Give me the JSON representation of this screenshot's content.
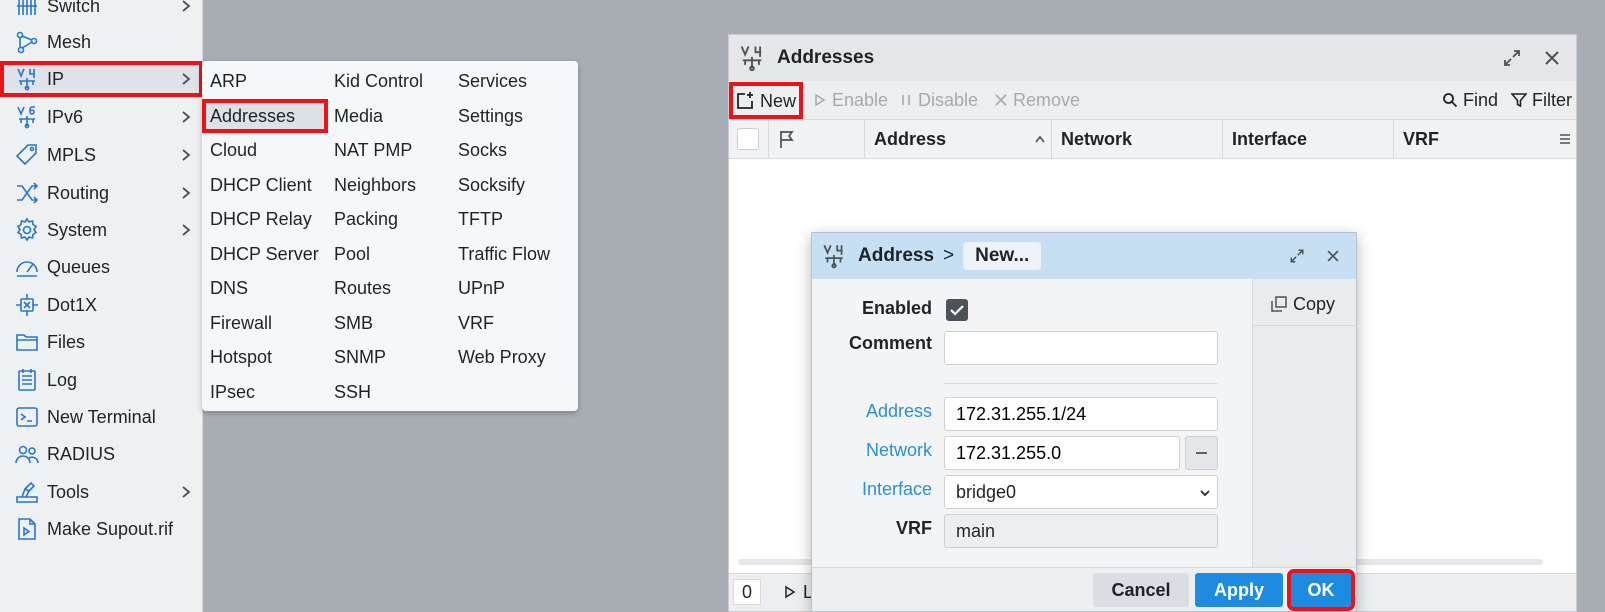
{
  "sidebar": {
    "items": [
      {
        "label": "Switch",
        "icon": "switch-icon",
        "has_submenu": true
      },
      {
        "label": "Mesh",
        "icon": "mesh-icon",
        "has_submenu": false
      },
      {
        "label": "IP",
        "icon": "ipv4-icon",
        "has_submenu": true,
        "active": true
      },
      {
        "label": "IPv6",
        "icon": "ipv6-icon",
        "has_submenu": true
      },
      {
        "label": "MPLS",
        "icon": "tag-icon",
        "has_submenu": true
      },
      {
        "label": "Routing",
        "icon": "routing-icon",
        "has_submenu": true
      },
      {
        "label": "System",
        "icon": "gear-icon",
        "has_submenu": true
      },
      {
        "label": "Queues",
        "icon": "gauge-icon",
        "has_submenu": false
      },
      {
        "label": "Dot1X",
        "icon": "dot1x-icon",
        "has_submenu": false
      },
      {
        "label": "Files",
        "icon": "folder-icon",
        "has_submenu": false
      },
      {
        "label": "Log",
        "icon": "log-icon",
        "has_submenu": false
      },
      {
        "label": "New Terminal",
        "icon": "terminal-icon",
        "has_submenu": false
      },
      {
        "label": "RADIUS",
        "icon": "users-icon",
        "has_submenu": false
      },
      {
        "label": "Tools",
        "icon": "tools-icon",
        "has_submenu": true
      },
      {
        "label": "Make Supout.rif",
        "icon": "file-play-icon",
        "has_submenu": false
      }
    ]
  },
  "submenu": {
    "col1": [
      "ARP",
      "Addresses",
      "Cloud",
      "DHCP Client",
      "DHCP Relay",
      "DHCP Server",
      "DNS",
      "Firewall",
      "Hotspot",
      "IPsec"
    ],
    "col2": [
      "Kid Control",
      "Media",
      "NAT PMP",
      "Neighbors",
      "Packing",
      "Pool",
      "Routes",
      "SMB",
      "SNMP",
      "SSH"
    ],
    "col3": [
      "Services",
      "Settings",
      "Socks",
      "Socksify",
      "TFTP",
      "Traffic Flow",
      "UPnP",
      "VRF",
      "Web Proxy"
    ],
    "highlighted": "Addresses"
  },
  "addresses_window": {
    "title": "Addresses",
    "toolbar": {
      "new": "New",
      "enable": "Enable",
      "disable": "Disable",
      "remove": "Remove",
      "find": "Find",
      "filter": "Filter"
    },
    "columns": [
      "Address",
      "Network",
      "Interface",
      "VRF"
    ],
    "status": {
      "count": "0",
      "partial_label": "L"
    }
  },
  "address_dialog": {
    "crumb_root": "Address",
    "crumb_sep": ">",
    "crumb_current": "New...",
    "copy_label": "Copy",
    "fields": {
      "enabled_label": "Enabled",
      "enabled_value": true,
      "comment_label": "Comment",
      "comment_value": "",
      "address_label": "Address",
      "address_value": "172.31.255.1/24",
      "network_label": "Network",
      "network_value": "172.31.255.0",
      "interface_label": "Interface",
      "interface_value": "bridge0",
      "vrf_label": "VRF",
      "vrf_value": "main"
    },
    "buttons": {
      "cancel": "Cancel",
      "apply": "Apply",
      "ok": "OK"
    }
  },
  "colors": {
    "highlight_outline": "#e8141a",
    "accent_blue": "#1d8ce0",
    "label_blue": "#2b8fd6",
    "dialog_title_bg": "#c7dff3",
    "icon_blue": "#2677c9"
  }
}
